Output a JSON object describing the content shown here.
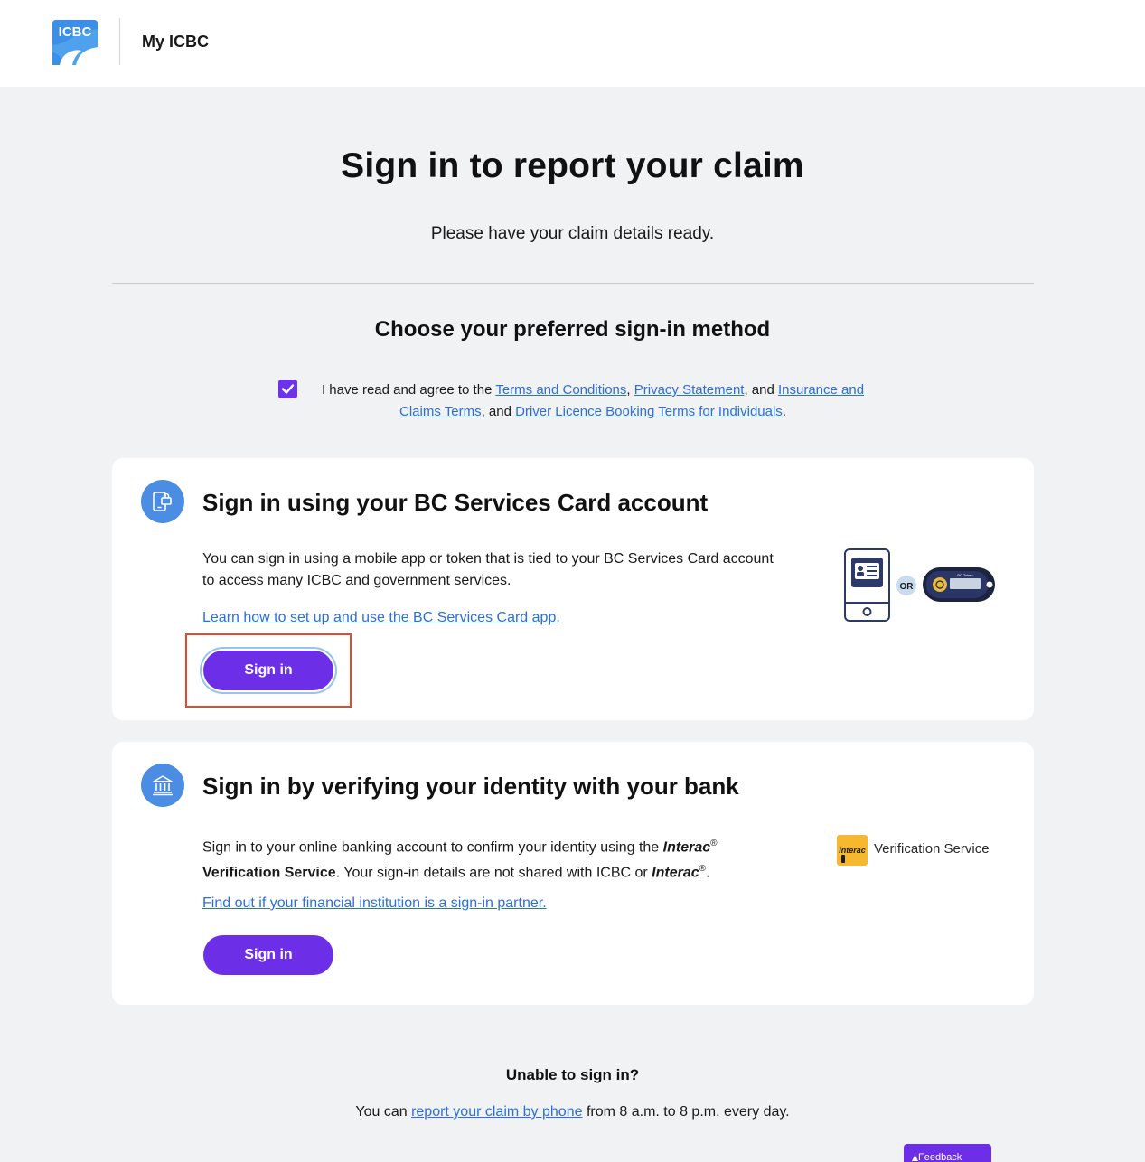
{
  "header": {
    "logo_text": "ICBC",
    "app_name": "My ICBC"
  },
  "page": {
    "title": "Sign in to report your claim",
    "subtitle": "Please have your claim details ready.",
    "method_title": "Choose your preferred sign-in method"
  },
  "agreement": {
    "checked": true,
    "prefix": "I have read and agree to the ",
    "terms_link": "Terms and Conditions",
    "sep1": ", ",
    "privacy_link": "Privacy Statement",
    "sep2": ", and ",
    "insurance_link": "Insurance and Claims Terms",
    "sep3": ", and ",
    "booking_link": "Driver Licence Booking Terms for Individuals",
    "suffix": "."
  },
  "bcsc_card": {
    "title": "Sign in using your BC Services Card account",
    "body": "You can sign in using a mobile app or token that is tied to your BC Services Card account to access many ICBC and government services.",
    "link": "Learn how to set up and use the BC Services Card app.",
    "button": "Sign in",
    "or_label": "OR",
    "token_label": "BC Token"
  },
  "bank_card": {
    "title": "Sign in by verifying your identity with your bank",
    "body_1": "Sign in to your online banking account to confirm your identity using the ",
    "interac_1": "Interac",
    "reg_1": "®",
    "body_2": " ",
    "verification_bold": "Verification Service",
    "body_3": ". Your sign-in details are not shared with ICBC or ",
    "interac_2": "Interac",
    "reg_2": "®",
    "body_4": ".",
    "link": "Find out if your financial institution is a sign-in partner.",
    "button": "Sign in",
    "logo_word": "Interac",
    "verification_service": "Verification Service"
  },
  "footer": {
    "unable_title": "Unable to sign in?",
    "phone_prefix": "You can ",
    "phone_link": "report your claim by phone",
    "phone_suffix": " from 8 a.m. to 8 p.m. every day.",
    "feedback": "Feedback"
  },
  "colors": {
    "accent": "#6c2ee6",
    "link": "#2d6fd8",
    "icon_blue": "#4a8de2",
    "highlight": "#e64a2e"
  }
}
